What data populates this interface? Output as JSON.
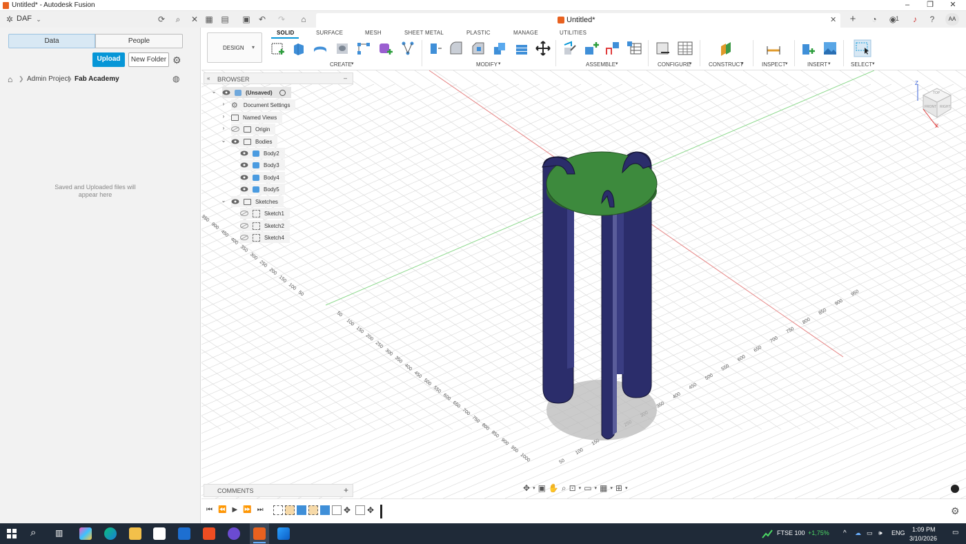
{
  "window": {
    "title": "Untitled* - Autodesk Fusion",
    "controls": [
      "–",
      "❐",
      "✕"
    ]
  },
  "appbar": {
    "team": "DAF",
    "doc_tab": "Untitled*",
    "badge_count": "1",
    "avatar": "AA"
  },
  "datapanel": {
    "tabs": [
      "Data",
      "People"
    ],
    "upload_label": "Upload",
    "new_folder_label": "New Folder",
    "breadcrumb": [
      "Admin Project",
      "Fab Academy"
    ],
    "empty_message": "Saved and Uploaded files will appear here"
  },
  "toolbar": {
    "workspace": "DESIGN",
    "tabs": [
      "SOLID",
      "SURFACE",
      "MESH",
      "SHEET METAL",
      "PLASTIC",
      "MANAGE",
      "UTILITIES"
    ],
    "active_tab": "SOLID",
    "groups": [
      "CREATE",
      "MODIFY",
      "ASSEMBLE",
      "CONFIGURE",
      "CONSTRUCT",
      "INSPECT",
      "INSERT",
      "SELECT"
    ]
  },
  "browser": {
    "title": "BROWSER",
    "root": "(Unsaved)",
    "items": [
      "Document Settings",
      "Named Views",
      "Origin",
      "Bodies",
      "Body2",
      "Body3",
      "Body4",
      "Body5",
      "Sketches",
      "Sketch1",
      "Sketch2",
      "Sketch4"
    ]
  },
  "viewcube": {
    "axes": [
      "Z",
      "X"
    ],
    "faces": [
      "TOP",
      "FRONT",
      "RIGHT"
    ]
  },
  "axis_labels": {
    "left_upper": [
      "950",
      "900",
      "450",
      "400",
      "350",
      "300",
      "250",
      "200",
      "150",
      "100",
      "50"
    ],
    "left_lower": [
      "50",
      "100",
      "150",
      "200",
      "250",
      "300",
      "350",
      "400",
      "450",
      "500",
      "550",
      "600",
      "650",
      "700",
      "750",
      "800",
      "850",
      "900",
      "950",
      "1000"
    ],
    "right": [
      "50",
      "100",
      "150",
      "200",
      "250",
      "300",
      "350",
      "400",
      "450",
      "500",
      "550",
      "600",
      "650",
      "700",
      "750",
      "800",
      "850",
      "900",
      "950"
    ]
  },
  "comments": {
    "label": "COMMENTS"
  },
  "taskbar": {
    "ticker": "FTSE 100",
    "ticker_change": "+1,75%",
    "lang": "ENG",
    "time": "1:09 PM",
    "date": "3/10/2026"
  },
  "colors": {
    "accent": "#0696d7",
    "body_blue": "#2b2d6b",
    "top_green": "#3d8a3d",
    "taskbar": "#1f2a38",
    "grid": "#d9d9d9"
  }
}
